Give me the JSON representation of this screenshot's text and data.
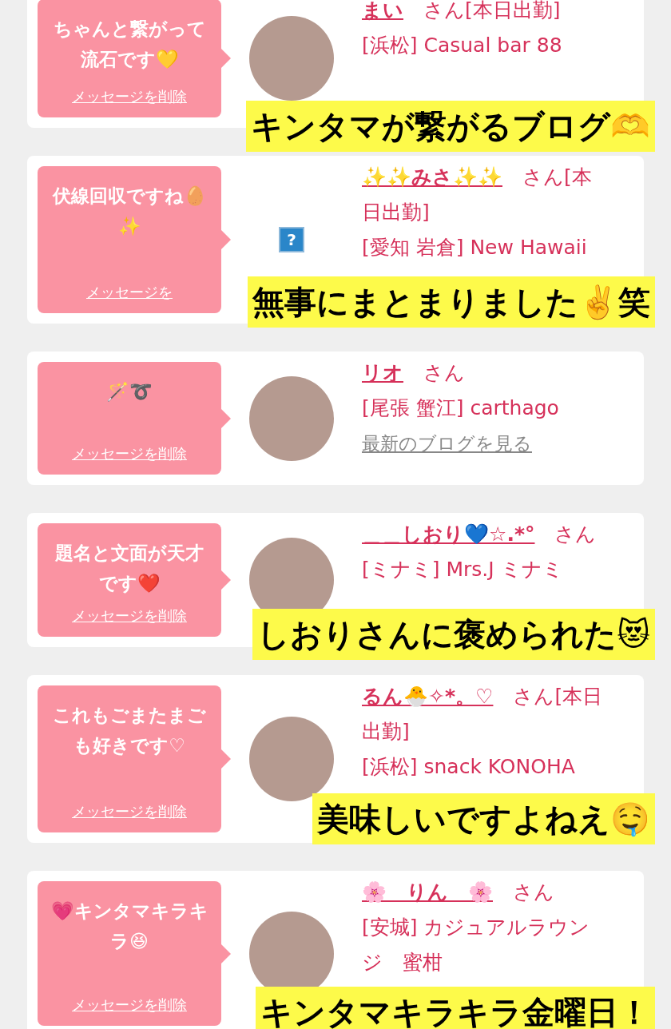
{
  "cards": [
    {
      "message": "ちゃんと繋がって流石です💛",
      "delete_link": "メッセージを削除",
      "has_photo": true,
      "name": "まい",
      "suffix": "さん[本日出勤]",
      "shop": "[浜松] Casual bar 88",
      "caption": "キンタマが繋がるブログ🫶"
    },
    {
      "message": "伏線回収ですね🥚✨",
      "delete_link": "メッセージを",
      "has_photo": false,
      "missing_mark": "?",
      "name": "✨✨みさ✨✨",
      "suffix": "さん[本日出勤]",
      "shop": "[愛知 岩倉] New Hawaii",
      "caption": "無事にまとまりました✌️笑"
    },
    {
      "message": "🪄➰",
      "delete_link": "メッセージを削除",
      "has_photo": true,
      "name": "リオ",
      "suffix": "さん",
      "shop": "[尾張 蟹江] carthago",
      "blog_link": "最新のブログを見る"
    },
    {
      "message": "題名と文面が天才です❤️",
      "delete_link": "メッセージを削除",
      "has_photo": true,
      "name": "＿＿しおり💙☆.*°",
      "suffix": "さん",
      "shop": "[ミナミ] Mrs.J ミナミ",
      "caption": "しおりさんに褒められた😻"
    },
    {
      "message": "これもごまたまごも好きです♡",
      "delete_link": "メッセージを削除",
      "has_photo": true,
      "name": "るん🐣✧*。♡",
      "suffix": "さん[本日出勤]",
      "shop": "[浜松] snack KONOHA",
      "caption": "美味しいですよねえ🤤"
    },
    {
      "message": "💗キンタマキラキラ😆",
      "delete_link": "メッセージを削除",
      "has_photo": true,
      "name": "🌸　りん　🌸",
      "suffix": "さん",
      "shop": "[安城] カジュアルラウンジ　蜜柑",
      "caption": "キンタマキラキラ金曜日！"
    }
  ]
}
